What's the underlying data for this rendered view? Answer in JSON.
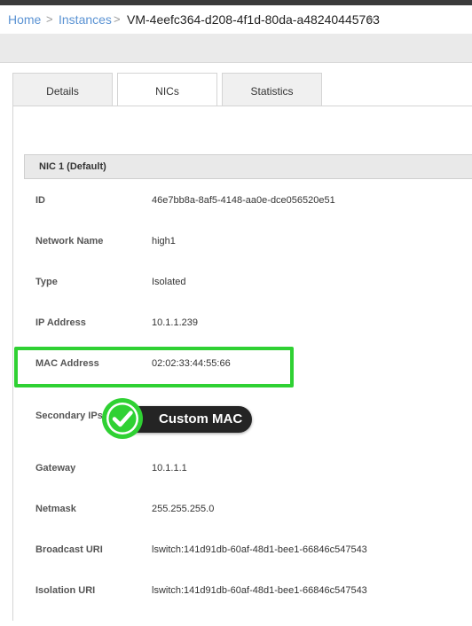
{
  "breadcrumb": {
    "home": "Home",
    "instances": "Instances",
    "current": "VM-4eefc364-d208-4f1d-80da-a48240445763",
    "separator": ">"
  },
  "tabs": [
    {
      "label": "Details",
      "active": false
    },
    {
      "label": "NICs",
      "active": true
    },
    {
      "label": "Statistics",
      "active": false
    }
  ],
  "nic": {
    "header": "NIC 1 (Default)",
    "fields": [
      {
        "label": "ID",
        "value": "46e7bb8a-8af5-4148-aa0e-dce056520e51"
      },
      {
        "label": "Network Name",
        "value": "high1"
      },
      {
        "label": "Type",
        "value": "Isolated"
      },
      {
        "label": "IP Address",
        "value": "10.1.1.239"
      },
      {
        "label": "MAC Address",
        "value": "02:02:33:44:55:66"
      },
      {
        "label": "Secondary IPs",
        "value": ""
      },
      {
        "label": "Gateway",
        "value": "10.1.1.1"
      },
      {
        "label": "Netmask",
        "value": "255.255.255.0"
      },
      {
        "label": "Broadcast URI",
        "value": "lswitch:141d91db-60af-48d1-bee1-66846c547543"
      },
      {
        "label": "Isolation URI",
        "value": "lswitch:141d91db-60af-48d1-bee1-66846c547543"
      }
    ]
  },
  "callout": {
    "text": "Custom MAC",
    "icon": "checkmark-icon"
  },
  "colors": {
    "link": "#5b93d3",
    "highlight": "#2fd133",
    "callout_bg": "#242424",
    "header_bar": "#3b3b3b"
  }
}
